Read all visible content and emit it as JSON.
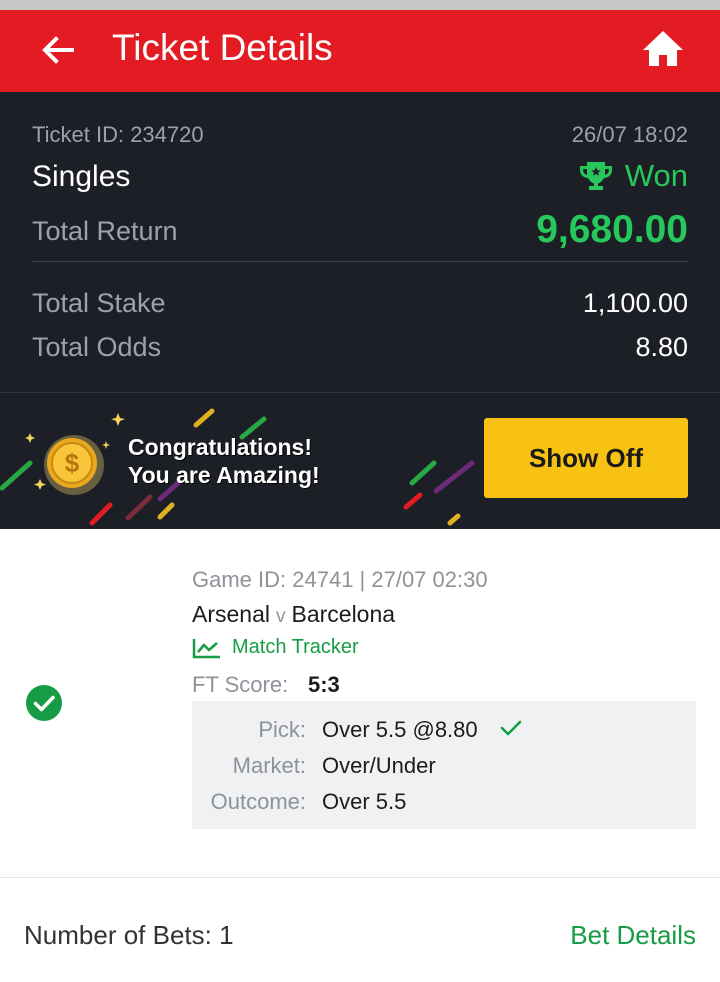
{
  "header": {
    "title": "Ticket Details",
    "background_color": "#e31b23",
    "back_icon": "arrow-left-icon",
    "home_icon": "home-icon"
  },
  "summary": {
    "ticket_id": "Ticket ID: 234720",
    "datetime": "26/07 18:02",
    "bet_type": "Singles",
    "status": "Won",
    "status_icon": "trophy-icon",
    "status_color": "#27c75b",
    "total_return_label": "Total Return",
    "total_return_value": "9,680.00",
    "total_stake_label": "Total Stake",
    "total_stake_value": "1,100.00",
    "total_odds_label": "Total Odds",
    "total_odds_value": "8.80"
  },
  "banner": {
    "line1": "Congratulations!",
    "line2": "You are Amazing!",
    "show_off_label": "Show Off",
    "button_color": "#f8c213",
    "coin_icon": "coin-icon"
  },
  "selection": {
    "game_id": "Game ID: 24741 | 27/07 02:30",
    "home_team": "Arsenal",
    "vs": "v",
    "away_team": "Barcelona",
    "tracker_label": "Match Tracker",
    "ft_label": "FT Score:",
    "ft_value": "5:3",
    "pick_label": "Pick:",
    "pick_value": "Over 5.5 @8.80",
    "market_label": "Market:",
    "market_value": "Over/Under",
    "outcome_label": "Outcome:",
    "outcome_value": "Over 5.5",
    "result_icon": "check-circle-icon"
  },
  "footer": {
    "bets_count": "Number of Bets: 1",
    "bet_details_label": "Bet Details",
    "link_color": "#159c45"
  }
}
